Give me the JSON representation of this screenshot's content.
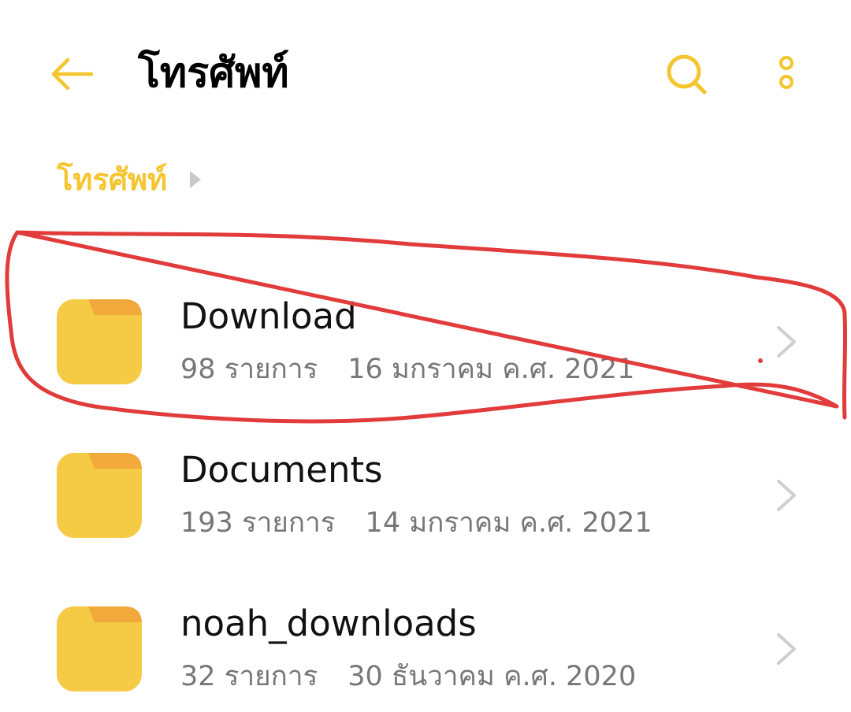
{
  "header": {
    "title": "โทรศัพท์",
    "back_icon": "back-arrow-icon",
    "search_icon": "search-icon",
    "more_icon": "more-vertical-icon"
  },
  "breadcrumb": {
    "items": [
      "โทรศัพท์"
    ],
    "separator_icon": "caret-right-icon"
  },
  "folders": [
    {
      "name": "Download",
      "count": "98 รายการ",
      "date": "16 มกราคม ค.ศ. 2021"
    },
    {
      "name": "Documents",
      "count": "193 รายการ",
      "date": "14 มกราคม ค.ศ. 2021"
    },
    {
      "name": "noah_downloads",
      "count": "32 รายการ",
      "date": "30 ธันวาคม ค.ศ. 2020"
    }
  ],
  "colors": {
    "accent": "#F5C52F",
    "folder_body": "#F5CA45",
    "folder_tab": "#F0A93A",
    "annotation": "#E23B3B",
    "secondary_text": "#777777"
  },
  "annotation": {
    "type": "hand-drawn red circle around first folder row"
  }
}
